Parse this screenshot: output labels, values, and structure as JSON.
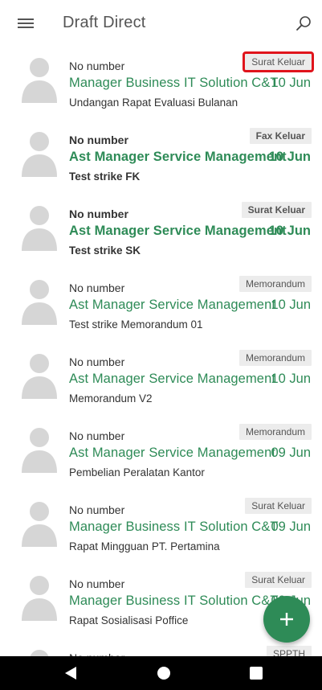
{
  "header": {
    "title": "Draft Direct",
    "menu_icon": "hamburger-menu-icon",
    "search_icon": "search-icon"
  },
  "colors": {
    "accent": "#2e8b57",
    "tag_bg": "#ececec",
    "highlight": "#e0141c",
    "navbar": "#000000"
  },
  "items": [
    {
      "number": "No number",
      "tag": "Surat Keluar",
      "sender": "Manager Business IT Solution C&T",
      "date": "10 Jun",
      "subject": "Undangan Rapat Evaluasi Bulanan",
      "unread": false,
      "highlighted": true
    },
    {
      "number": "No number",
      "tag": "Fax Keluar",
      "sender": "Ast Manager Service Management",
      "date": "10 Jun",
      "subject": "Test strike FK",
      "unread": true,
      "highlighted": false
    },
    {
      "number": "No number",
      "tag": "Surat Keluar",
      "sender": "Ast Manager Service Management",
      "date": "10 Jun",
      "subject": "Test strike SK",
      "unread": true,
      "highlighted": false
    },
    {
      "number": "No number",
      "tag": "Memorandum",
      "sender": "Ast Manager Service Management",
      "date": "10 Jun",
      "subject": "Test strike Memorandum 01",
      "unread": false,
      "highlighted": false
    },
    {
      "number": "No number",
      "tag": "Memorandum",
      "sender": "Ast Manager Service Management",
      "date": "10 Jun",
      "subject": "Memorandum V2",
      "unread": false,
      "highlighted": false
    },
    {
      "number": "No number",
      "tag": "Memorandum",
      "sender": "Ast Manager Service Management",
      "date": "09 Jun",
      "subject": "Pembelian Peralatan Kantor",
      "unread": false,
      "highlighted": false
    },
    {
      "number": "No number",
      "tag": "Surat Keluar",
      "sender": "Manager Business IT Solution C&T",
      "date": "09 Jun",
      "subject": "Rapat Mingguan PT. Pertamina",
      "unread": false,
      "highlighted": false
    },
    {
      "number": "No number",
      "tag": "Surat Keluar",
      "sender": "Manager Business IT Solution C&T",
      "date": "09 Jun",
      "subject": "Rapat Sosialisasi Poffice",
      "unread": false,
      "highlighted": false
    },
    {
      "number": "No number",
      "tag": "SPPTH",
      "sender": "",
      "date": "",
      "subject": "",
      "unread": false,
      "highlighted": false
    }
  ],
  "fab": {
    "icon": "plus-icon"
  },
  "navbar": {
    "back_icon": "back-triangle-icon",
    "home_icon": "home-circle-icon",
    "recents_icon": "recents-square-icon"
  }
}
